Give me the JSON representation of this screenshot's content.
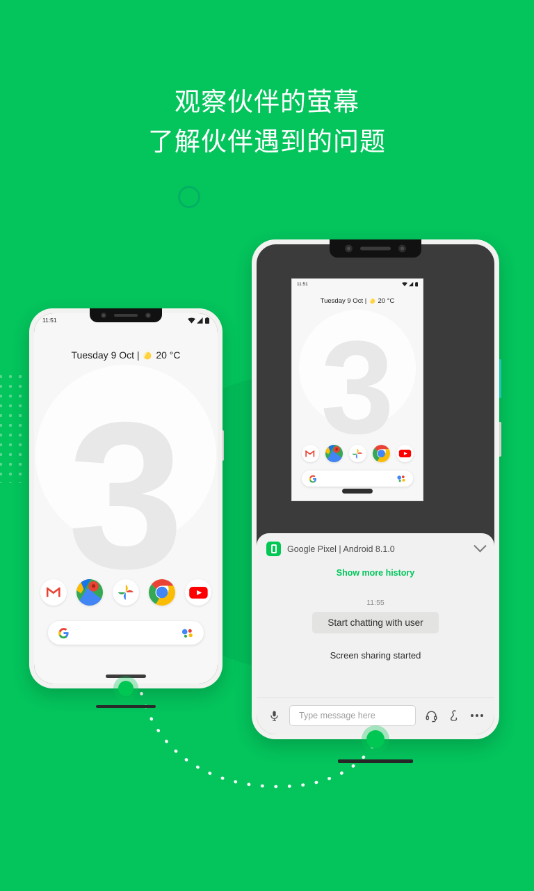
{
  "theme": {
    "background_green": "#04C45C",
    "accent_green": "#00C65A",
    "indicator_green": "#00C853"
  },
  "headline": {
    "line1": "观察伙伴的萤幕",
    "line2": "了解伙伴遇到的问题"
  },
  "phone_screen": {
    "status_time": "11:51",
    "wifi_icon": "wifi-icon",
    "signal_icon": "signal-icon",
    "battery_icon": "battery-icon",
    "date_weather": "Tuesday 9 Oct | ",
    "weather_icon": "sun-icon",
    "temperature": "20 °C",
    "wallpaper_digit": "3",
    "apps": [
      {
        "name": "gmail",
        "label": "Gmail"
      },
      {
        "name": "maps",
        "label": "Maps"
      },
      {
        "name": "photos",
        "label": "Photos"
      },
      {
        "name": "chrome",
        "label": "Chrome"
      },
      {
        "name": "youtube",
        "label": "YouTube"
      }
    ],
    "search_icon": "google-g-icon",
    "assistant_icon": "google-assistant-icon"
  },
  "chat_panel": {
    "device_icon": "device-phone-icon",
    "device_name": "Google Pixel | Android 8.1.0",
    "collapse_icon": "chevron-down-icon",
    "show_more_history": "Show more history",
    "message_time": "11:55",
    "message_bubble": "Start chatting with user",
    "system_message": "Screen sharing started",
    "input": {
      "mic_icon": "microphone-icon",
      "placeholder": "Type message here",
      "value": "",
      "headset_icon": "headset-icon",
      "gesture_icon": "remote-control-icon",
      "more_icon": "more-options-icon"
    }
  }
}
